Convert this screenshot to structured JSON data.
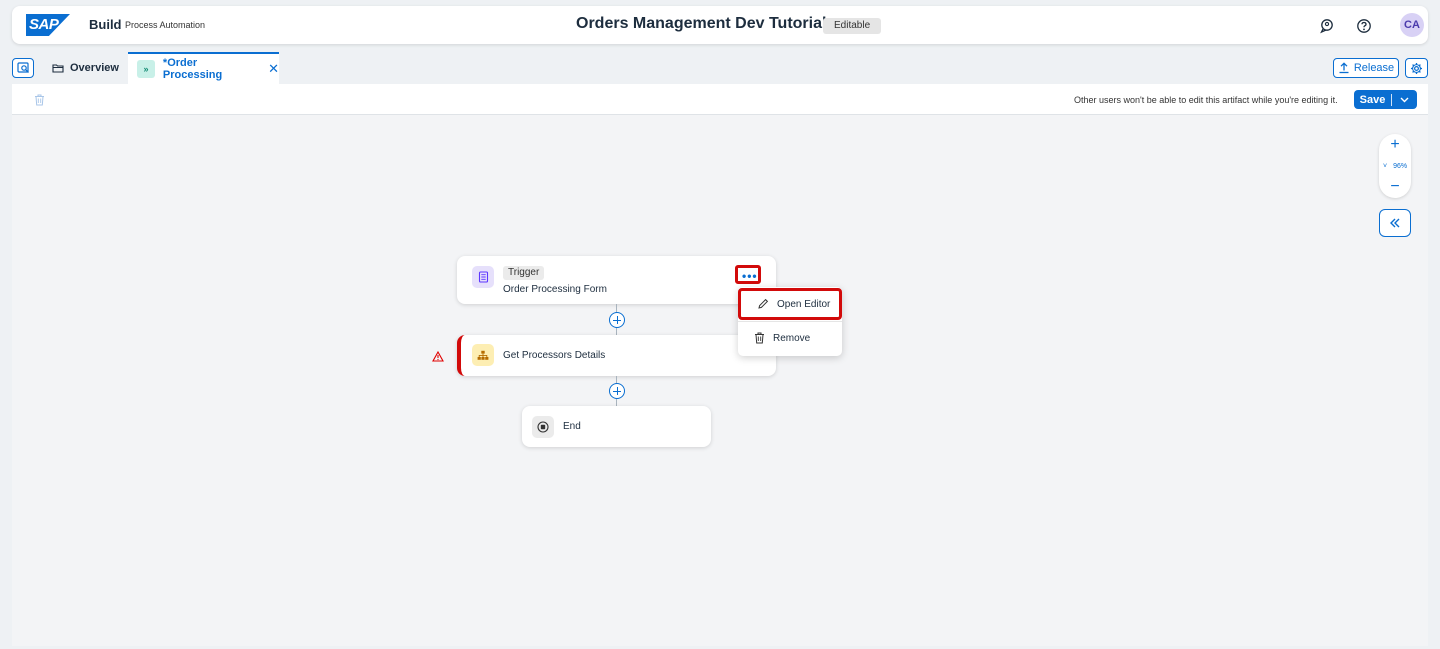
{
  "shell": {
    "logo_text": "SAP",
    "product": "Build",
    "product_sub": "Process Automation",
    "project_title": "Orders Management Dev Tutorial",
    "badge": "Editable",
    "avatar": "CA"
  },
  "tabs": {
    "overview_label": "Overview",
    "active_label": "*Order Processing",
    "active_chip": "»",
    "release_label": "Release"
  },
  "toolbar": {
    "lock_message": "Other users won't be able to edit this artifact while you're editing it.",
    "save_label": "Save"
  },
  "canvas": {
    "zoom_level": "96%",
    "nodes": {
      "trigger": {
        "badge": "Trigger",
        "title": "Order Processing Form"
      },
      "action": {
        "title": "Get Processors Details"
      },
      "end": {
        "title": "End"
      }
    },
    "context_menu": {
      "open_editor": "Open Editor",
      "remove": "Remove"
    }
  },
  "colors": {
    "accent": "#0a6ed1",
    "highlight": "#d20a0a",
    "warning": "#e00000",
    "form_icon_bg": "#e6e0fb",
    "action_icon_bg": "#fdeeb3"
  }
}
